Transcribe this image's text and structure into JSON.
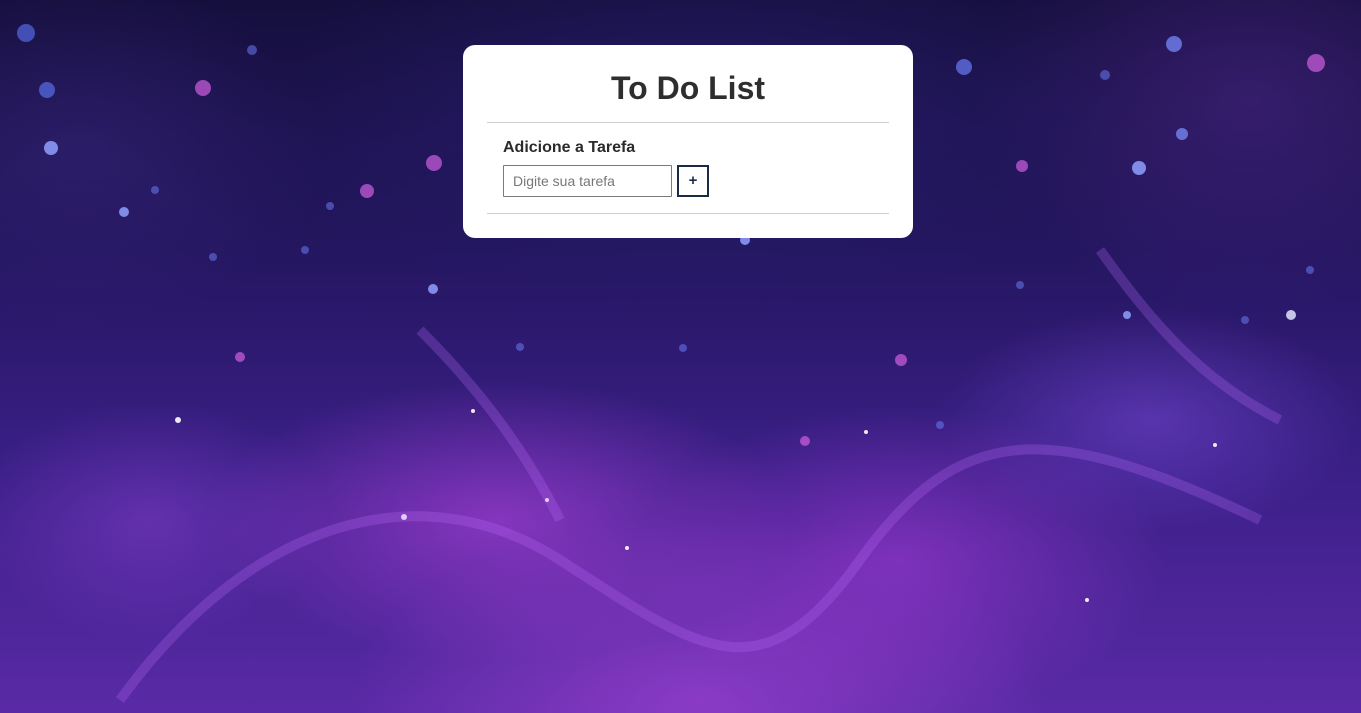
{
  "app": {
    "title": "To Do List"
  },
  "form": {
    "label": "Adicione a Tarefa",
    "input_value": "",
    "input_placeholder": "Digite sua tarefa",
    "add_button_label": "+"
  },
  "theme": {
    "card_background": "#ffffff",
    "button_border": "#1c2b45",
    "background_style": "purple galaxy nebula"
  }
}
